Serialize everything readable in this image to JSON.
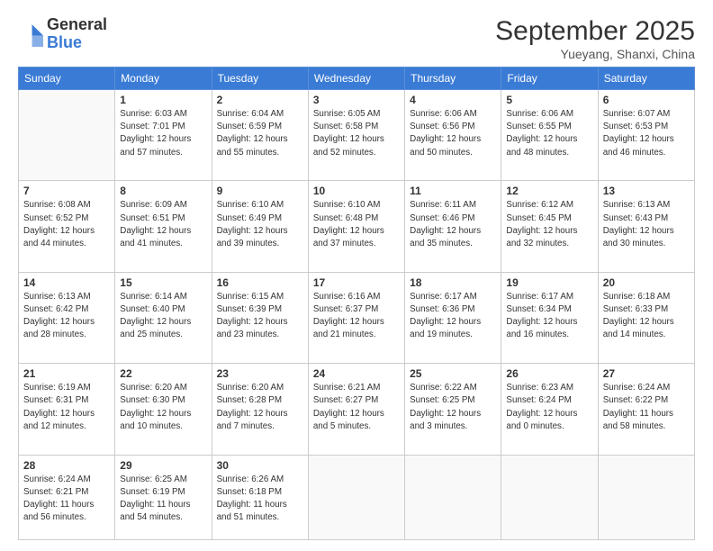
{
  "header": {
    "logo_general": "General",
    "logo_blue": "Blue",
    "month": "September 2025",
    "location": "Yueyang, Shanxi, China"
  },
  "weekdays": [
    "Sunday",
    "Monday",
    "Tuesday",
    "Wednesday",
    "Thursday",
    "Friday",
    "Saturday"
  ],
  "weeks": [
    [
      {
        "day": "",
        "info": ""
      },
      {
        "day": "1",
        "info": "Sunrise: 6:03 AM\nSunset: 7:01 PM\nDaylight: 12 hours\nand 57 minutes."
      },
      {
        "day": "2",
        "info": "Sunrise: 6:04 AM\nSunset: 6:59 PM\nDaylight: 12 hours\nand 55 minutes."
      },
      {
        "day": "3",
        "info": "Sunrise: 6:05 AM\nSunset: 6:58 PM\nDaylight: 12 hours\nand 52 minutes."
      },
      {
        "day": "4",
        "info": "Sunrise: 6:06 AM\nSunset: 6:56 PM\nDaylight: 12 hours\nand 50 minutes."
      },
      {
        "day": "5",
        "info": "Sunrise: 6:06 AM\nSunset: 6:55 PM\nDaylight: 12 hours\nand 48 minutes."
      },
      {
        "day": "6",
        "info": "Sunrise: 6:07 AM\nSunset: 6:53 PM\nDaylight: 12 hours\nand 46 minutes."
      }
    ],
    [
      {
        "day": "7",
        "info": "Sunrise: 6:08 AM\nSunset: 6:52 PM\nDaylight: 12 hours\nand 44 minutes."
      },
      {
        "day": "8",
        "info": "Sunrise: 6:09 AM\nSunset: 6:51 PM\nDaylight: 12 hours\nand 41 minutes."
      },
      {
        "day": "9",
        "info": "Sunrise: 6:10 AM\nSunset: 6:49 PM\nDaylight: 12 hours\nand 39 minutes."
      },
      {
        "day": "10",
        "info": "Sunrise: 6:10 AM\nSunset: 6:48 PM\nDaylight: 12 hours\nand 37 minutes."
      },
      {
        "day": "11",
        "info": "Sunrise: 6:11 AM\nSunset: 6:46 PM\nDaylight: 12 hours\nand 35 minutes."
      },
      {
        "day": "12",
        "info": "Sunrise: 6:12 AM\nSunset: 6:45 PM\nDaylight: 12 hours\nand 32 minutes."
      },
      {
        "day": "13",
        "info": "Sunrise: 6:13 AM\nSunset: 6:43 PM\nDaylight: 12 hours\nand 30 minutes."
      }
    ],
    [
      {
        "day": "14",
        "info": "Sunrise: 6:13 AM\nSunset: 6:42 PM\nDaylight: 12 hours\nand 28 minutes."
      },
      {
        "day": "15",
        "info": "Sunrise: 6:14 AM\nSunset: 6:40 PM\nDaylight: 12 hours\nand 25 minutes."
      },
      {
        "day": "16",
        "info": "Sunrise: 6:15 AM\nSunset: 6:39 PM\nDaylight: 12 hours\nand 23 minutes."
      },
      {
        "day": "17",
        "info": "Sunrise: 6:16 AM\nSunset: 6:37 PM\nDaylight: 12 hours\nand 21 minutes."
      },
      {
        "day": "18",
        "info": "Sunrise: 6:17 AM\nSunset: 6:36 PM\nDaylight: 12 hours\nand 19 minutes."
      },
      {
        "day": "19",
        "info": "Sunrise: 6:17 AM\nSunset: 6:34 PM\nDaylight: 12 hours\nand 16 minutes."
      },
      {
        "day": "20",
        "info": "Sunrise: 6:18 AM\nSunset: 6:33 PM\nDaylight: 12 hours\nand 14 minutes."
      }
    ],
    [
      {
        "day": "21",
        "info": "Sunrise: 6:19 AM\nSunset: 6:31 PM\nDaylight: 12 hours\nand 12 minutes."
      },
      {
        "day": "22",
        "info": "Sunrise: 6:20 AM\nSunset: 6:30 PM\nDaylight: 12 hours\nand 10 minutes."
      },
      {
        "day": "23",
        "info": "Sunrise: 6:20 AM\nSunset: 6:28 PM\nDaylight: 12 hours\nand 7 minutes."
      },
      {
        "day": "24",
        "info": "Sunrise: 6:21 AM\nSunset: 6:27 PM\nDaylight: 12 hours\nand 5 minutes."
      },
      {
        "day": "25",
        "info": "Sunrise: 6:22 AM\nSunset: 6:25 PM\nDaylight: 12 hours\nand 3 minutes."
      },
      {
        "day": "26",
        "info": "Sunrise: 6:23 AM\nSunset: 6:24 PM\nDaylight: 12 hours\nand 0 minutes."
      },
      {
        "day": "27",
        "info": "Sunrise: 6:24 AM\nSunset: 6:22 PM\nDaylight: 11 hours\nand 58 minutes."
      }
    ],
    [
      {
        "day": "28",
        "info": "Sunrise: 6:24 AM\nSunset: 6:21 PM\nDaylight: 11 hours\nand 56 minutes."
      },
      {
        "day": "29",
        "info": "Sunrise: 6:25 AM\nSunset: 6:19 PM\nDaylight: 11 hours\nand 54 minutes."
      },
      {
        "day": "30",
        "info": "Sunrise: 6:26 AM\nSunset: 6:18 PM\nDaylight: 11 hours\nand 51 minutes."
      },
      {
        "day": "",
        "info": ""
      },
      {
        "day": "",
        "info": ""
      },
      {
        "day": "",
        "info": ""
      },
      {
        "day": "",
        "info": ""
      }
    ]
  ]
}
